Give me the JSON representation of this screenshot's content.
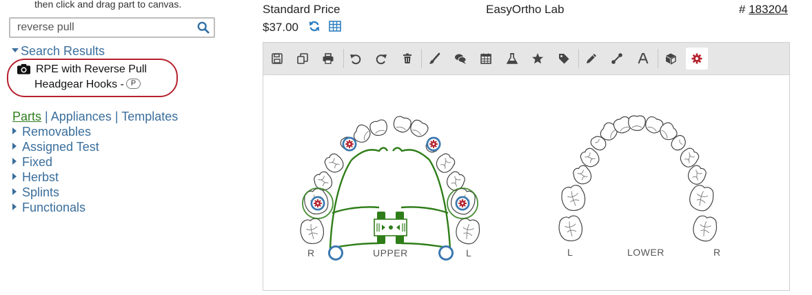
{
  "left": {
    "hint": "then click and drag part to canvas.",
    "search": {
      "value": "reverse pull",
      "placeholder": ""
    },
    "results_header": "Search Results",
    "result": {
      "line1": "RPE with Reverse Pull",
      "line2": "Headgear Hooks -",
      "badge": "P"
    },
    "tabs": {
      "parts": "Parts",
      "appliances": "Appliances",
      "templates": "Templates",
      "separator": "|"
    },
    "tree": [
      "Removables",
      "Assigned Test",
      "Fixed",
      "Herbst",
      "Splints",
      "Functionals"
    ]
  },
  "header": {
    "price_label": "Standard Price",
    "price_value": "$37.00",
    "lab": "EasyOrtho Lab",
    "order_prefix": "#",
    "order_number": "183204"
  },
  "toolbar": {
    "icons": [
      "save-icon",
      "copy-icon",
      "print-icon",
      "undo-icon",
      "redo-icon",
      "trash-icon",
      "brush-icon",
      "comments-icon",
      "calendar-icon",
      "flask-icon",
      "star-icon",
      "tag-icon",
      "pencil-icon",
      "connector-icon",
      "text-icon",
      "cube-icon",
      "gear-icon"
    ]
  },
  "canvas": {
    "upper": {
      "r": "R",
      "name": "UPPER",
      "l": "L"
    },
    "lower": {
      "l": "L",
      "name": "LOWER",
      "r": "R"
    }
  },
  "colors": {
    "link": "#3a6e9c",
    "active_tab": "#2f7d1e",
    "highlight_border": "#b5202c",
    "appliance_green": "#2e7d18",
    "band_blue": "#3a78b0",
    "gear_red": "#b5202c"
  }
}
